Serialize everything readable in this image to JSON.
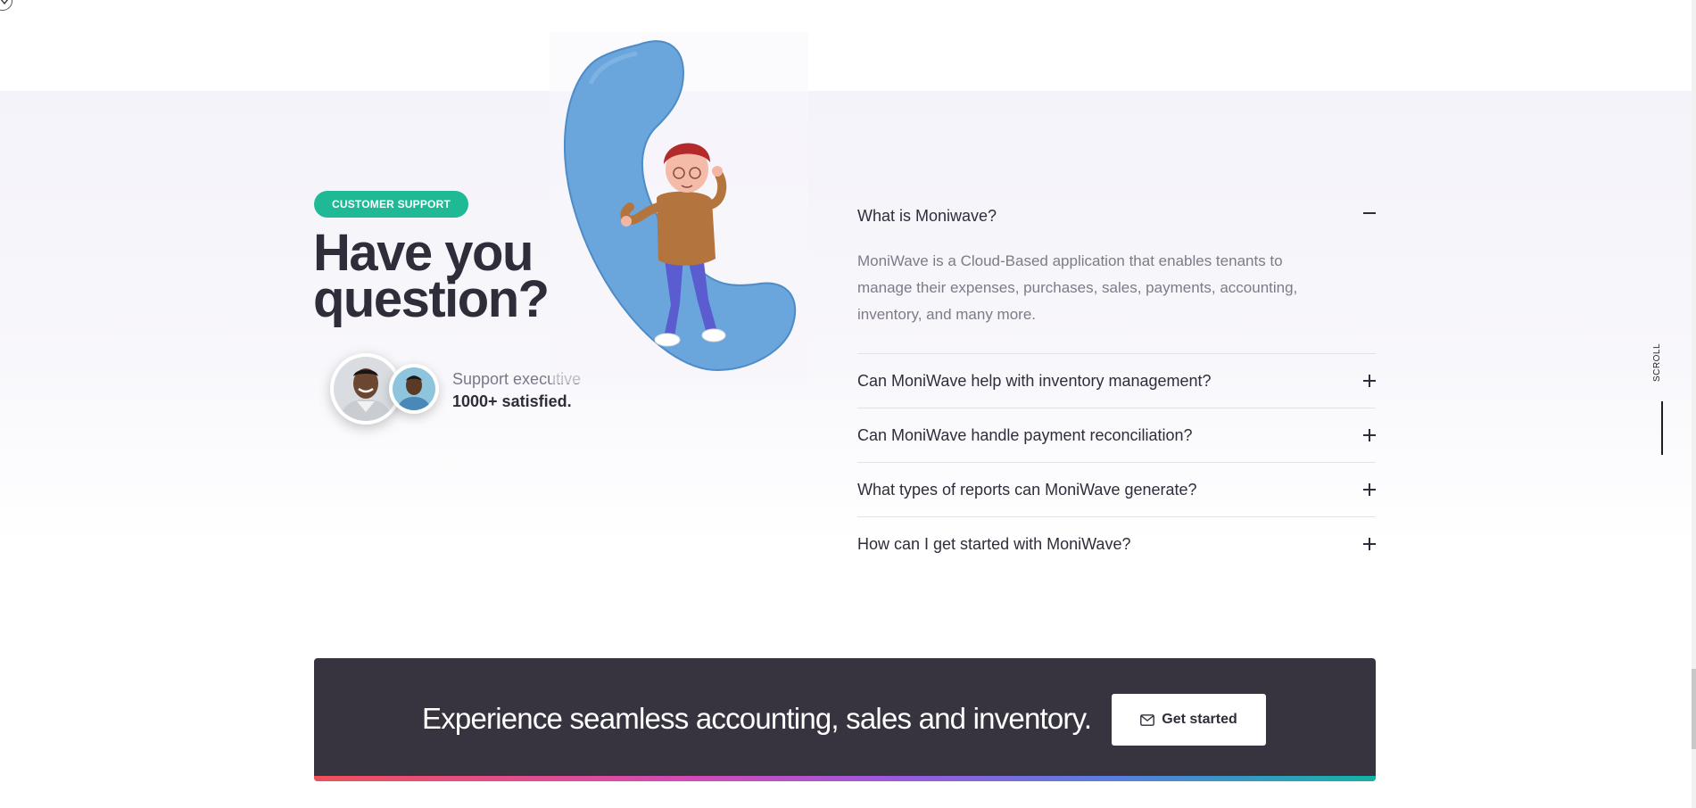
{
  "badge": {
    "label": "CUSTOMER SUPPORT"
  },
  "headline": {
    "line1": "Have you",
    "line2": "question?"
  },
  "support": {
    "title": "Support executive",
    "count": "1000+ satisfied."
  },
  "faq": {
    "items": [
      {
        "question": "What is Moniwave?",
        "answer": "MoniWave is a Cloud-Based application that enables tenants to manage their expenses, purchases, sales, payments, accounting, inventory, and many more.",
        "open": true
      },
      {
        "question": "Can MoniWave help with inventory management?",
        "open": false
      },
      {
        "question": "Can MoniWave handle payment reconciliation?",
        "open": false
      },
      {
        "question": "What types of reports can MoniWave generate?",
        "open": false
      },
      {
        "question": "How can I get started with MoniWave?",
        "open": false
      }
    ]
  },
  "scroll": {
    "label": "SCROLL"
  },
  "cta": {
    "text": "Experience seamless accounting, sales and inventory.",
    "button_label": "Get started"
  },
  "colors": {
    "accent": "#1fb996",
    "dark": "#37343f",
    "text": "#2f2d3a",
    "muted": "#7d7b88"
  }
}
